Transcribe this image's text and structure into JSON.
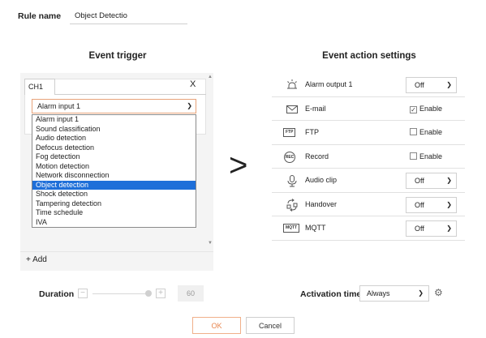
{
  "rule": {
    "label": "Rule name",
    "value": "Object Detectio"
  },
  "event_trigger": {
    "title": "Event trigger",
    "tab": "CH1",
    "close": "X",
    "selected_value": "Alarm input 1",
    "options": [
      "Alarm input 1",
      "Sound classification",
      "Audio detection",
      "Defocus detection",
      "Fog detection",
      "Motion detection",
      "Network disconnection",
      "Object detection",
      "Shock detection",
      "Tampering detection",
      "Time schedule",
      "IVA"
    ],
    "highlighted_option": "Object detection",
    "add_label": "+ Add"
  },
  "arrow": ">",
  "event_action": {
    "title": "Event action settings",
    "rows": [
      {
        "name": "Alarm output 1",
        "icon": "alarm-output-icon",
        "control": "select",
        "value": "Off"
      },
      {
        "name": "E-mail",
        "icon": "mail-icon",
        "control": "checkbox",
        "checked": true,
        "label": "Enable"
      },
      {
        "name": "FTP",
        "icon": "ftp-icon",
        "icon_text": "FTP",
        "control": "checkbox",
        "checked": false,
        "label": "Enable"
      },
      {
        "name": "Record",
        "icon": "record-icon",
        "icon_text": "REC",
        "control": "checkbox",
        "checked": false,
        "label": "Enable"
      },
      {
        "name": "Audio clip",
        "icon": "audio-clip-icon",
        "control": "select",
        "value": "Off"
      },
      {
        "name": "Handover",
        "icon": "handover-icon",
        "control": "select",
        "value": "Off"
      },
      {
        "name": "MQTT",
        "icon": "mqtt-icon",
        "icon_text": "MQTT",
        "control": "select",
        "value": "Off"
      }
    ]
  },
  "duration": {
    "label": "Duration",
    "minus": "−",
    "plus": "+",
    "value": "60"
  },
  "activation": {
    "label": "Activation time",
    "value": "Always"
  },
  "buttons": {
    "ok": "OK",
    "cancel": "Cancel"
  },
  "colors": {
    "accent": "#e8864f",
    "selection": "#1e6fd9",
    "panel_bg": "#f4f4f4"
  }
}
